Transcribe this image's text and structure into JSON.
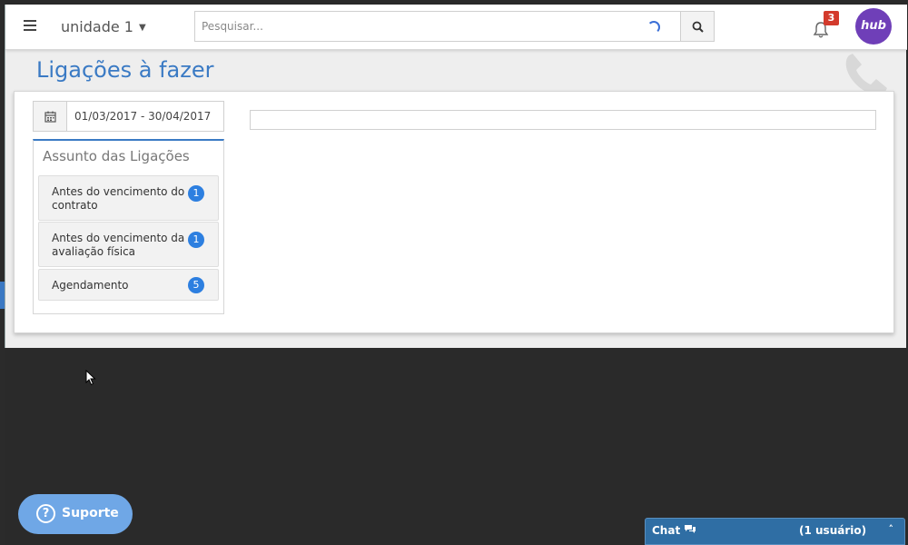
{
  "header": {
    "unit_label": "unidade 1",
    "search_placeholder": "Pesquisar...",
    "notifications_count": "3",
    "avatar_text": "hub"
  },
  "page": {
    "title": "Ligações à fazer"
  },
  "filters": {
    "date_range": "01/03/2017 - 30/04/2017"
  },
  "subjects": {
    "title": "Assunto das Ligações",
    "items": [
      {
        "label_line1": "Antes do vencimento do",
        "label_line2": "contrato",
        "count": "1"
      },
      {
        "label_line1": "Antes do vencimento da",
        "label_line2": "avaliação física",
        "count": "1"
      },
      {
        "label_line1": "Agendamento",
        "label_line2": "",
        "count": "5"
      }
    ]
  },
  "support": {
    "label": "Suporte"
  },
  "chat": {
    "label": "Chat",
    "users": "(1 usuário)",
    "toggle": "˄"
  },
  "colors": {
    "accent": "#3a7ac4",
    "badge_red": "#d33a2c",
    "count_blue": "#2d7fe0",
    "avatar_purple": "#6f3fb8",
    "chat_bar": "#2f6ea4"
  }
}
